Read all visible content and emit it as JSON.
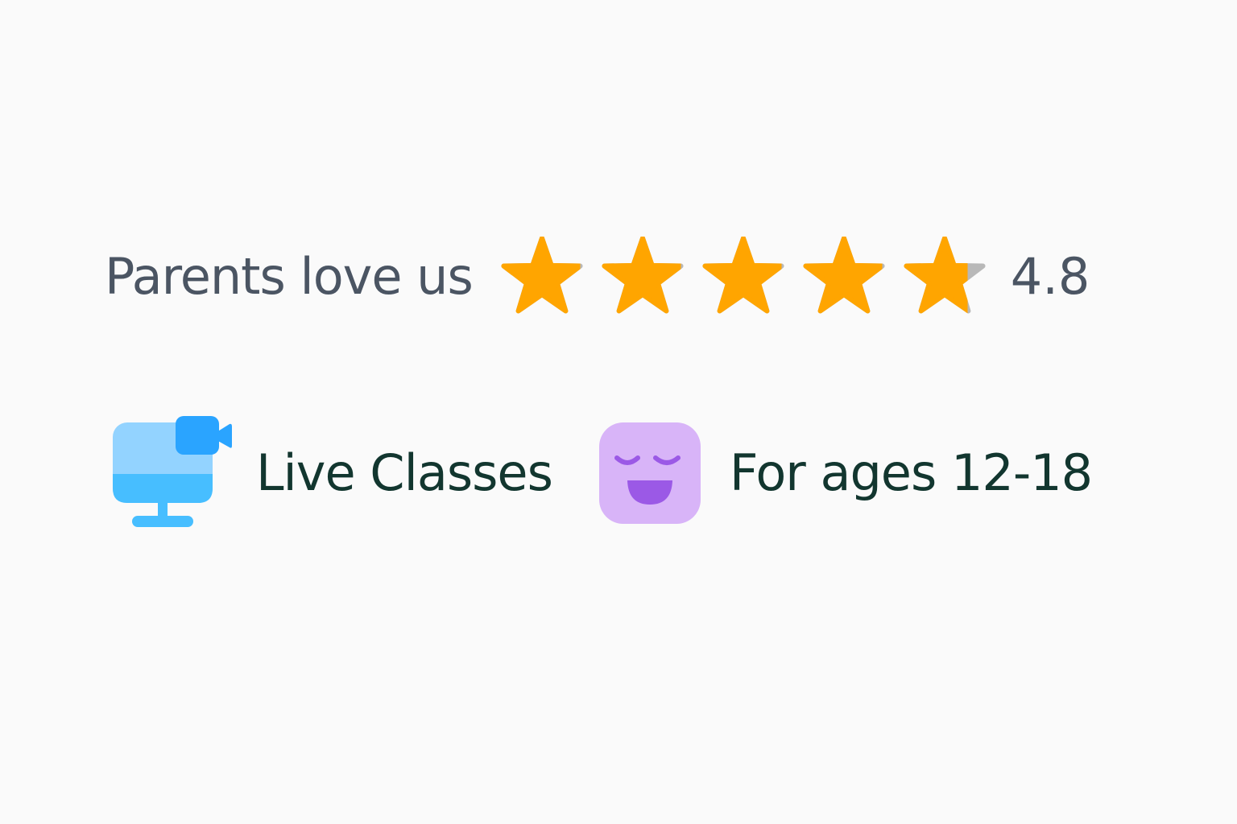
{
  "rating": {
    "label": "Parents love us",
    "value": "4.8",
    "stars_total": 5,
    "stars_filled": 4.8,
    "star_color": "#FFA500",
    "star_empty_color": "#B8B8B8"
  },
  "features": [
    {
      "label": "Live Classes",
      "icon": "video-monitor-icon",
      "icon_colors": [
        "#93D3FF",
        "#47BEFF",
        "#2AA4FF"
      ]
    },
    {
      "label": "For ages 12-18",
      "icon": "happy-face-icon",
      "icon_colors": [
        "#D8B4F8",
        "#9B59E6"
      ]
    }
  ],
  "colors": {
    "background": "#FAFAFA",
    "rating_text": "#4B5563",
    "feature_text": "#12362F"
  }
}
